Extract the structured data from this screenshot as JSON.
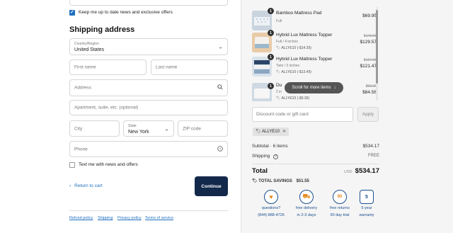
{
  "newsletter": {
    "label": "Keep me up to date news and exclusive offers",
    "checked": true
  },
  "shipping": {
    "heading": "Shipping address",
    "country": {
      "label": "Country/Region",
      "value": "United States"
    },
    "first_name": {
      "placeholder": "First name"
    },
    "last_name": {
      "placeholder": "Last name"
    },
    "address": {
      "placeholder": "Address"
    },
    "apartment": {
      "placeholder": "Apartment, suite, etc. (optional)"
    },
    "city": {
      "placeholder": "City"
    },
    "state": {
      "label": "State",
      "value": "New York"
    },
    "zip": {
      "placeholder": "ZIP code"
    },
    "phone": {
      "placeholder": "Phone"
    },
    "text_me": {
      "label": "Text me with news and offers",
      "checked": false
    }
  },
  "actions": {
    "back_label": "Return to cart",
    "continue_label": "Continue"
  },
  "footer_links": [
    "Refund policy",
    "Shipping",
    "Privacy policy",
    "Terms of service"
  ],
  "cart_items": [
    {
      "qty": "1",
      "name": "Bamboo Mattress Pad",
      "variant": "Full",
      "discount": "",
      "original": "",
      "price": "$69.95"
    },
    {
      "qty": "1",
      "name": "Hybrid Lux Mattress Topper",
      "variant": "Full / 4 inches",
      "discount": "ALLYE10 (-$14.39)",
      "original": "$143.96",
      "price": "$129.57"
    },
    {
      "qty": "1",
      "name": "Hybrid Lux Mattress Topper",
      "variant": "Twin / 3 inches",
      "discount": "ALLYE10 (-$13.49)",
      "original": "$134.96",
      "price": "$121.47"
    },
    {
      "qty": "1",
      "name": "Du",
      "variant": "2 in",
      "discount": "ALLYE10 (-$9.39)",
      "original": "$93.95",
      "price": "$84.56"
    }
  ],
  "scroll_hint": "Scroll for more items",
  "discount": {
    "placeholder": "Discount code or gift card",
    "apply_label": "Apply",
    "applied_code": "ALLYE10"
  },
  "summary": {
    "subtotal_label": "Subtotal · 6 items",
    "subtotal_value": "$534.17",
    "shipping_label": "Shipping",
    "shipping_value": "FREE",
    "total_label": "Total",
    "currency": "USD",
    "total_value": "$534.17",
    "savings_label": "TOTAL SAVINGS",
    "savings_value": "$51.55"
  },
  "promos": [
    {
      "icon": "heart-chat-icon",
      "line1": "questions?",
      "line2": "(844) 888-4726"
    },
    {
      "icon": "truck-icon",
      "line1": "free delivery",
      "line2": "in 2-3 days"
    },
    {
      "icon": "moon-icon",
      "line1": "free returns",
      "line2": "90 day trial",
      "badge": "90"
    },
    {
      "icon": "shield-icon",
      "line1": "5 year",
      "line2": "warranty",
      "badge": "5"
    }
  ],
  "colors": {
    "accent": "#1f6fbf",
    "button": "#13294b",
    "promo": "#1b4f8f",
    "promo_accent": "#e38a1f"
  }
}
